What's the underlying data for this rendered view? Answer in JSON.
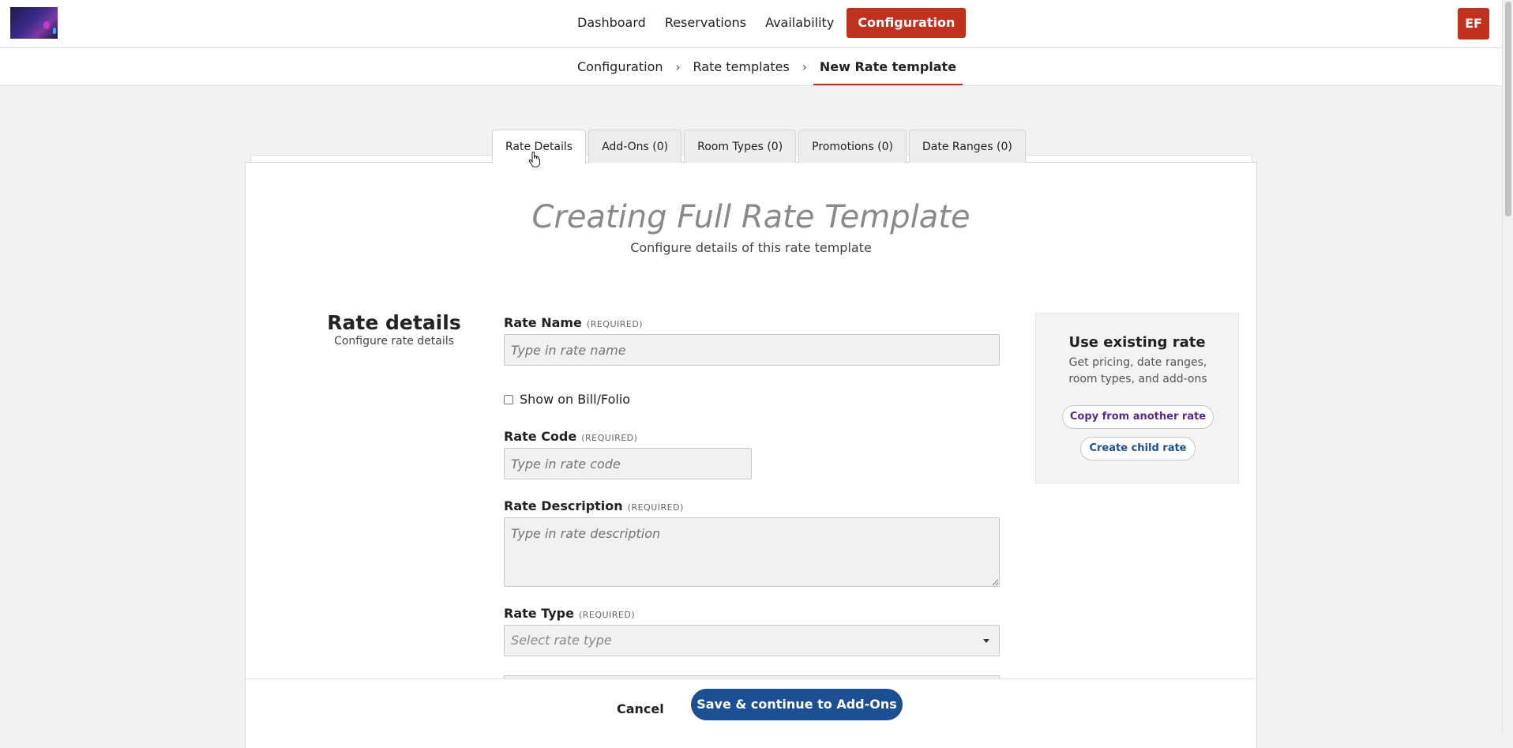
{
  "nav": {
    "items": [
      {
        "label": "Dashboard",
        "active": false
      },
      {
        "label": "Reservations",
        "active": false
      },
      {
        "label": "Availability",
        "active": false
      },
      {
        "label": "Configuration",
        "active": true
      }
    ],
    "avatar_initials": "EF"
  },
  "breadcrumb": {
    "items": [
      "Configuration",
      "Rate templates"
    ],
    "separator": "›",
    "current": "New Rate template"
  },
  "tabs": [
    {
      "label": "Rate Details",
      "active": true
    },
    {
      "label": "Add-Ons (0)",
      "active": false
    },
    {
      "label": "Room Types (0)",
      "active": false
    },
    {
      "label": "Promotions (0)",
      "active": false
    },
    {
      "label": "Date Ranges (0)",
      "active": false
    }
  ],
  "card": {
    "title": "Creating Full Rate Template",
    "subtitle": "Configure details of this rate template"
  },
  "section": {
    "title": "Rate details",
    "subtitle": "Configure rate details"
  },
  "form": {
    "required_tag": "(REQUIRED)",
    "rate_name": {
      "label": "Rate Name",
      "placeholder": "Type in rate name"
    },
    "show_on_bill": {
      "label": "Show on Bill/Folio",
      "checked": false
    },
    "rate_code": {
      "label": "Rate Code",
      "placeholder": "Type in rate code"
    },
    "rate_description": {
      "label": "Rate Description",
      "placeholder": "Type in rate description"
    },
    "rate_type": {
      "label": "Rate Type",
      "placeholder": "Select rate type"
    }
  },
  "side_panel": {
    "title": "Use existing rate",
    "description": "Get pricing, date ranges, room types, and add-ons",
    "copy_button": "Copy from another rate",
    "child_button": "Create child rate"
  },
  "footer": {
    "cancel_label": "Cancel",
    "save_label": "Save & continue to Add-Ons"
  },
  "colors": {
    "accent_red": "#c0311e",
    "primary_blue": "#1d4f93",
    "purple_link": "#5a2a8a"
  }
}
